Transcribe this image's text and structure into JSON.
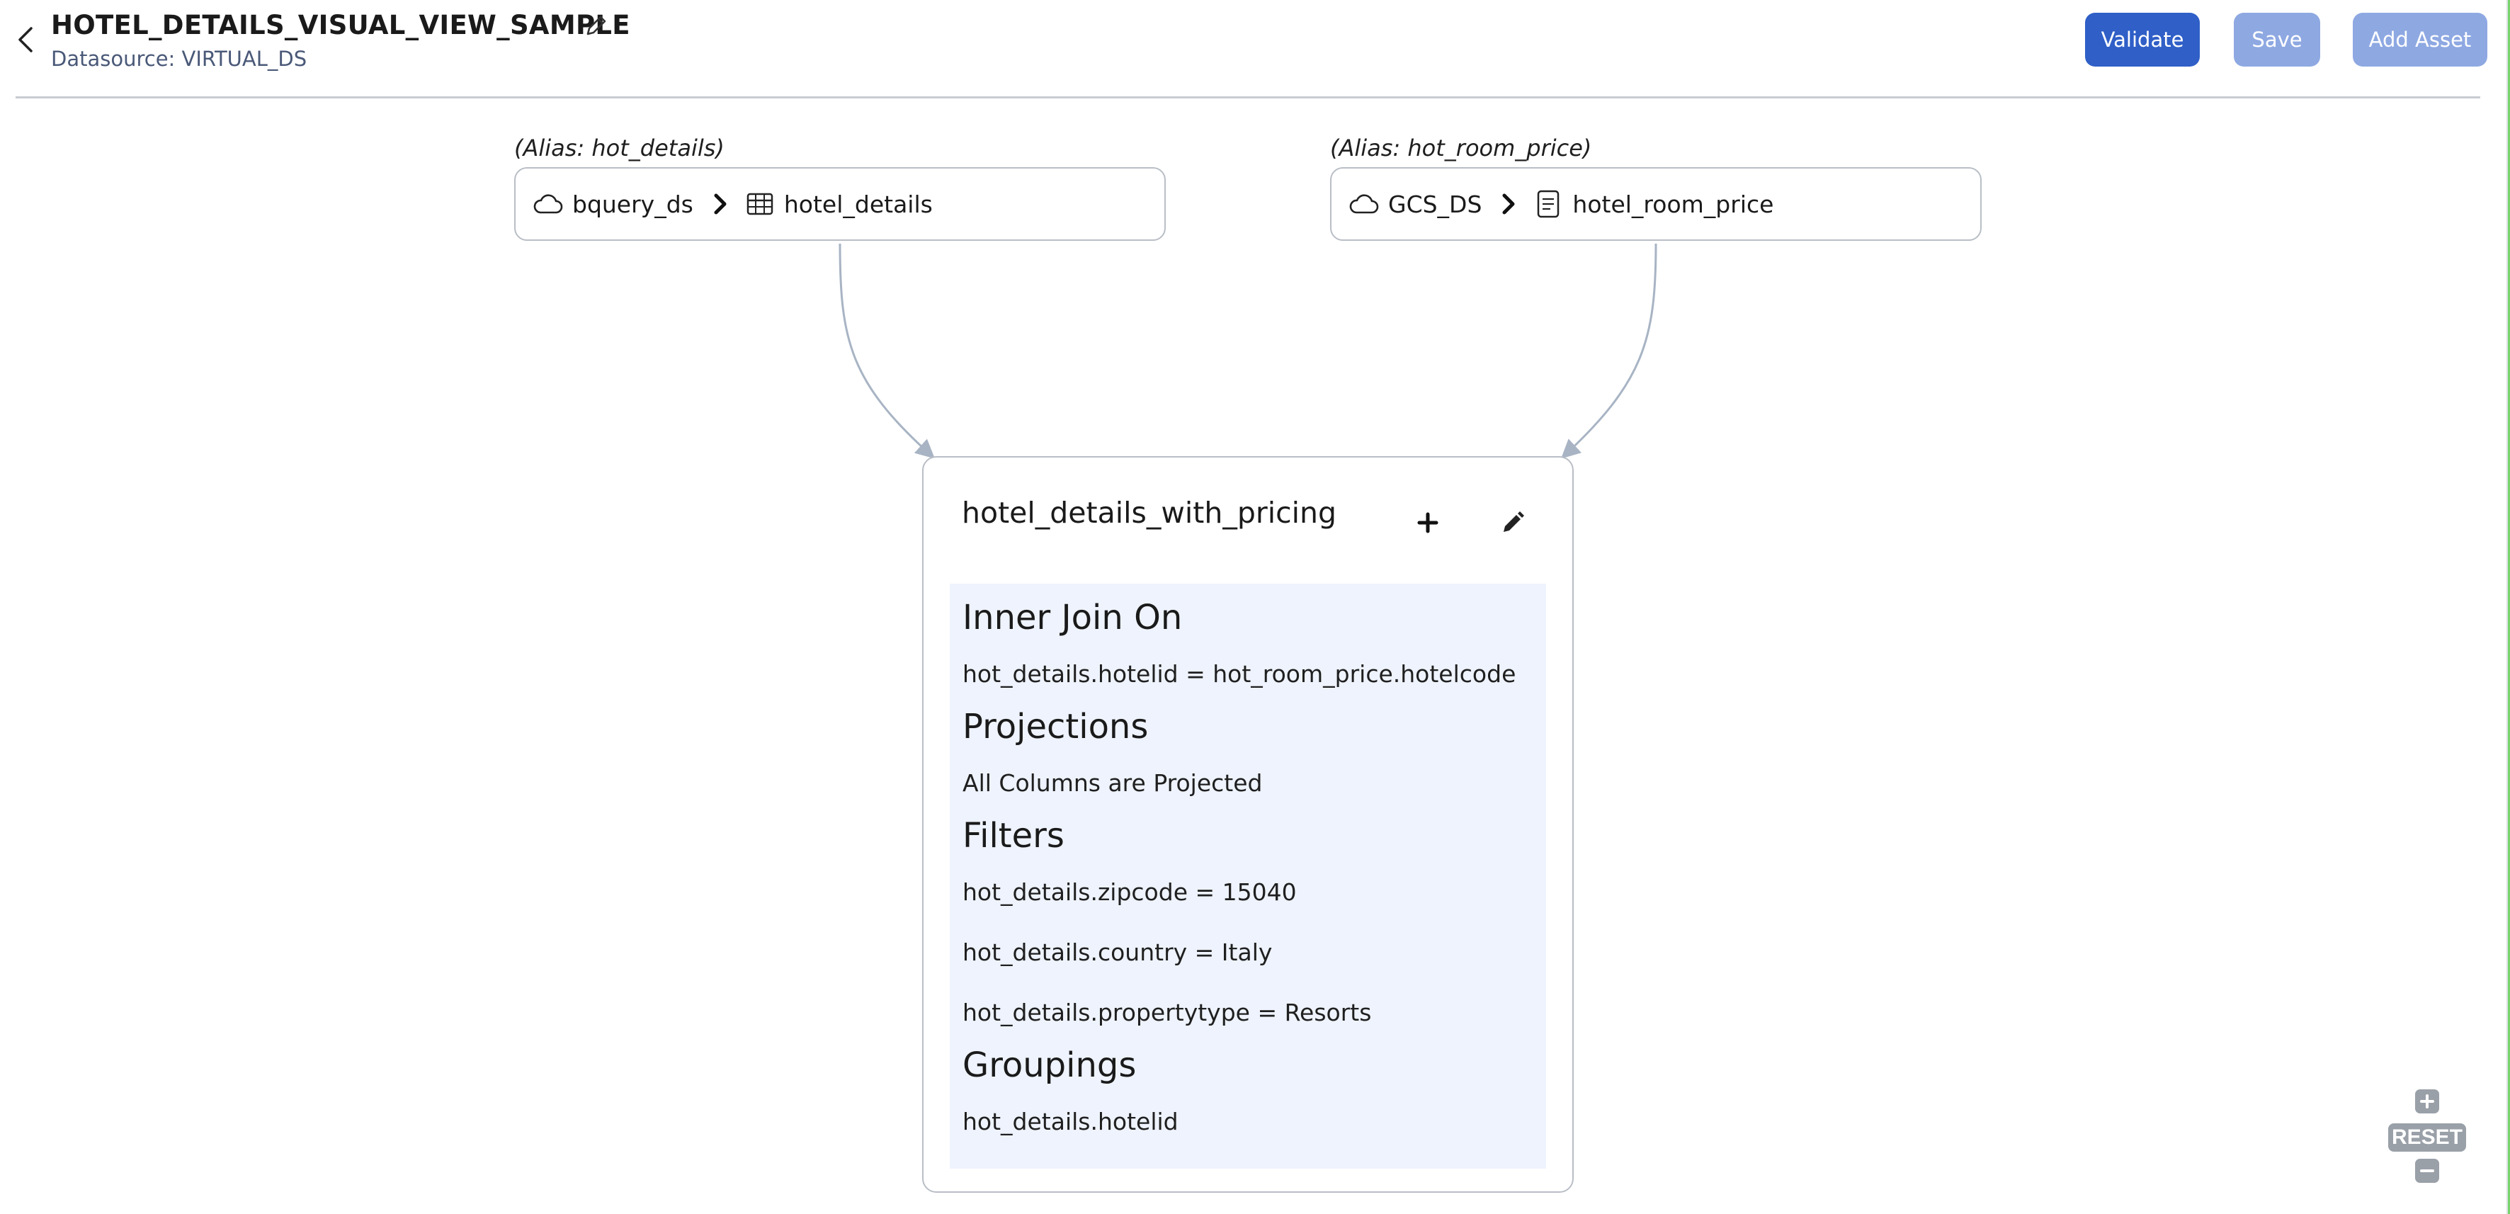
{
  "header": {
    "title": "HOTEL_DETAILS_VISUAL_VIEW_SAMPLE",
    "subtitle": "Datasource: VIRTUAL_DS",
    "buttons": {
      "validate": "Validate",
      "save": "Save",
      "add_asset": "Add Asset"
    }
  },
  "sources": [
    {
      "alias": "(Alias: hot_details)",
      "datasource": "bquery_ds",
      "asset": "hotel_details",
      "datasource_icon": "cloud-icon",
      "asset_icon": "table-icon"
    },
    {
      "alias": "(Alias: hot_room_price)",
      "datasource": "GCS_DS",
      "asset": "hotel_room_price",
      "datasource_icon": "cloud-icon",
      "asset_icon": "file-icon"
    }
  ],
  "join_node": {
    "title": "hotel_details_with_pricing",
    "sections": {
      "join": {
        "heading": "Inner Join On",
        "items": [
          "hot_details.hotelid = hot_room_price.hotelcode"
        ]
      },
      "projections": {
        "heading": "Projections",
        "items": [
          "All Columns are Projected"
        ]
      },
      "filters": {
        "heading": "Filters",
        "items": [
          "hot_details.zipcode = 15040",
          "hot_details.country = Italy",
          "hot_details.propertytype = Resorts"
        ]
      },
      "groupings": {
        "heading": "Groupings",
        "items": [
          "hot_details.hotelid"
        ]
      }
    }
  },
  "zoom": {
    "reset": "RESET"
  },
  "colors": {
    "primary": "#2f5fc7",
    "primary_disabled": "#8ea8e2",
    "edge": "#a8b4c4",
    "panel": "#eef3fd"
  }
}
